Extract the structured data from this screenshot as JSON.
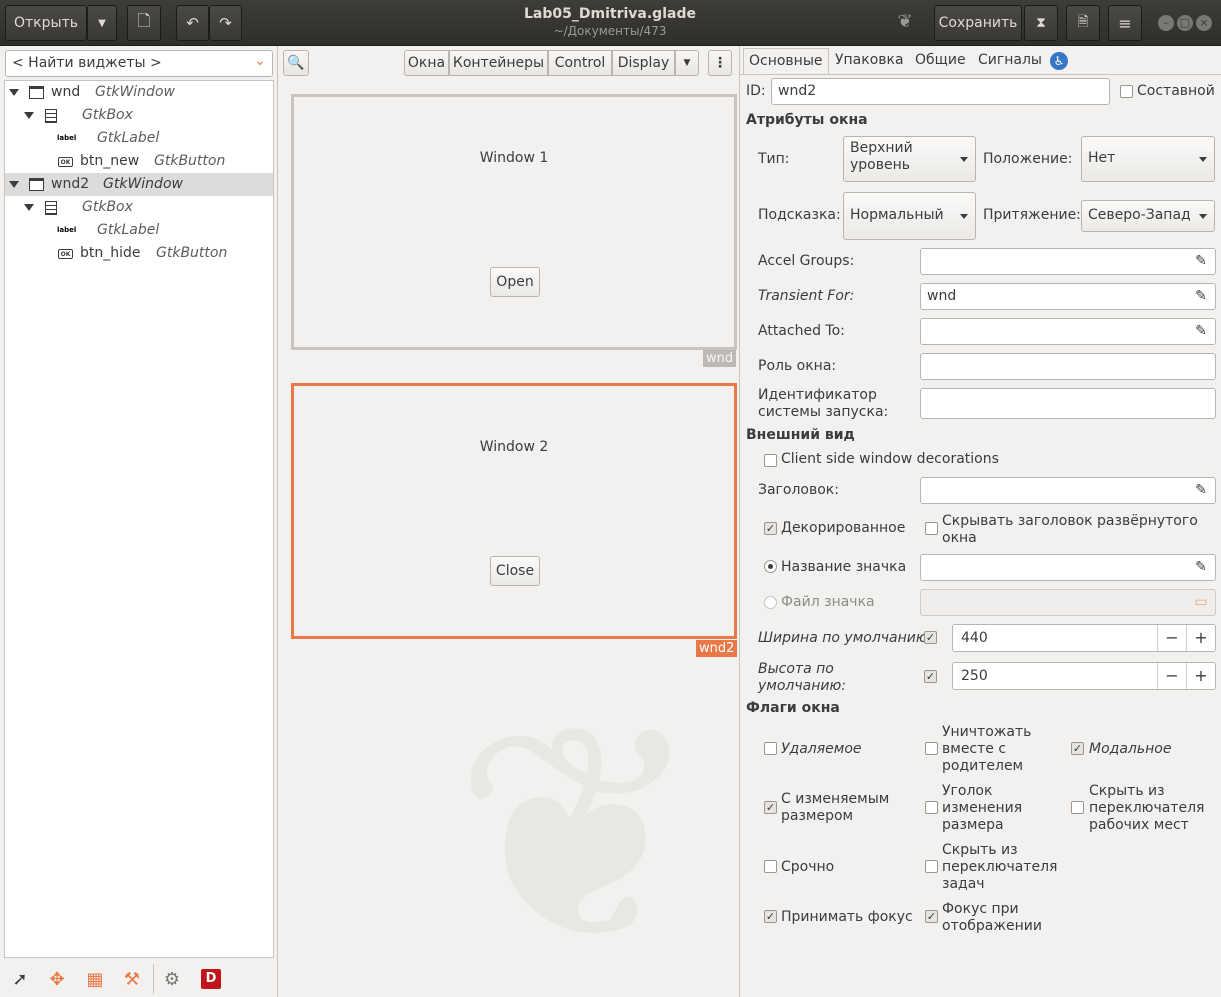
{
  "header": {
    "open_label": "Открыть",
    "save_label": "Сохранить",
    "title": "Lab05_Dmitriva.glade",
    "subtitle": "~/Документы/473"
  },
  "palette": {
    "search_placeholder": "< Найти виджеты >",
    "tree": [
      {
        "name": "wnd",
        "class": "GtkWindow"
      },
      {
        "name": "",
        "class": "GtkBox"
      },
      {
        "name": "",
        "class": "GtkLabel"
      },
      {
        "name": "btn_new",
        "class": "GtkButton"
      },
      {
        "name": "wnd2",
        "class": "GtkWindow"
      },
      {
        "name": "",
        "class": "GtkBox"
      },
      {
        "name": "",
        "class": "GtkLabel"
      },
      {
        "name": "btn_hide",
        "class": "GtkButton"
      }
    ],
    "label_icon_text": "label",
    "button_icon_text": "OK"
  },
  "center": {
    "toolbar": [
      "Окна",
      "Контейнеры",
      "Control",
      "Display"
    ],
    "window1": {
      "label": "Window 1",
      "button": "Open",
      "tag": "wnd"
    },
    "window2": {
      "label": "Window 2",
      "button": "Close",
      "tag": "wnd2"
    }
  },
  "props": {
    "tabs": [
      "Основные",
      "Упаковка",
      "Общие",
      "Сигналы"
    ],
    "id_label": "ID:",
    "id_value": "wnd2",
    "composite_label": "Составной",
    "window_attrs_title": "Атрибуты окна",
    "type_label": "Тип:",
    "type_value": "Верхний уровень",
    "position_label": "Положение:",
    "position_value": "Нет",
    "hint_label": "Подсказка:",
    "hint_value": "Нормальный",
    "gravity_label": "Притяжение:",
    "gravity_value": "Северо-Запад",
    "accel_label": "Accel Groups:",
    "accel_value": "",
    "transient_label": "Transient For:",
    "transient_value": "wnd",
    "attached_label": "Attached To:",
    "attached_value": "",
    "role_label": "Роль окна:",
    "role_value": "",
    "startup_label": "Идентификатор системы запуска:",
    "startup_value": "",
    "appearance_title": "Внешний вид",
    "csd_label": "Client side window decorations",
    "title_label": "Заголовок:",
    "title_value": "",
    "decorated_label": "Декорированное",
    "hide_titlebar_label": "Скрывать заголовок развёрнутого окна",
    "icon_name_label": "Название значка",
    "icon_file_label": "Файл значка",
    "default_width_label": "Ширина по умолчанию:",
    "default_width_value": "440",
    "default_height_label": "Высота по умолчанию:",
    "default_height_value": "250",
    "flags_title": "Флаги окна",
    "deletable_label": "Удаляемое",
    "destroy_with_parent_label": "Уничтожать вместе с родителем",
    "modal_label": "Модальное",
    "resizable_label": "С изменяемым размером",
    "resize_grip_label": "Уголок изменения размера",
    "skip_pager_label": "Скрыть из переключателя рабочих мест",
    "urgent_label": "Срочно",
    "skip_taskbar_label": "Скрыть из переключателя задач",
    "accept_focus_label": "Принимать фокус",
    "focus_on_map_label": "Фокус при отображении"
  },
  "colors": {
    "accent": "#e97a47",
    "header_bg": "#35342f"
  }
}
